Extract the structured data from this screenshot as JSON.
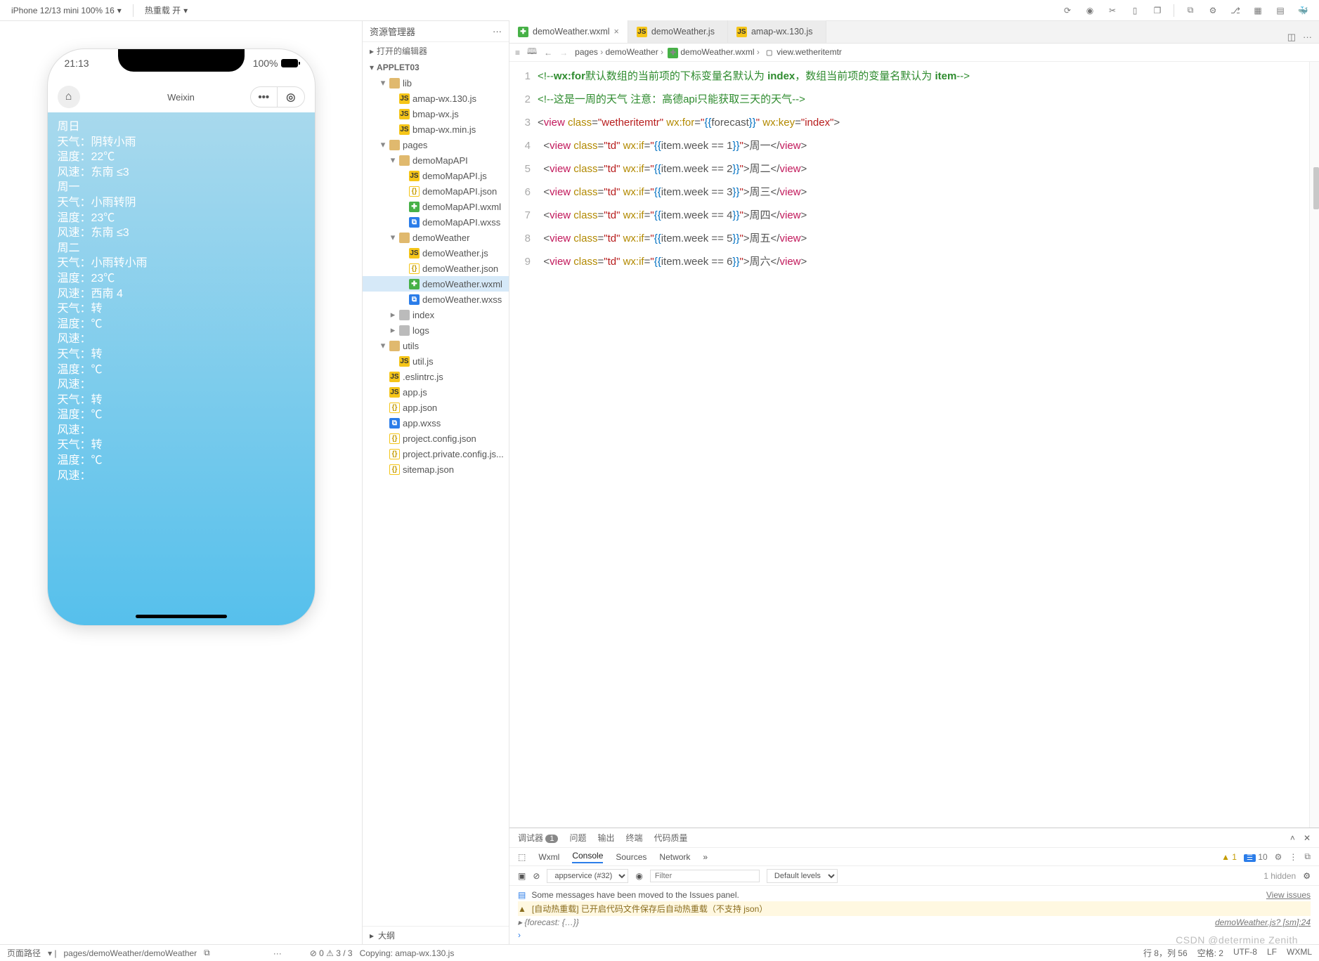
{
  "toolbar": {
    "device": "iPhone 12/13 mini 100% 16",
    "hot_reload": "热重载 开"
  },
  "simulator": {
    "time": "21:13",
    "battery": "100%",
    "title": "Weixin",
    "lines": [
      "周日",
      "天气：阴转小雨",
      "温度：22℃",
      "风速：东南 ≤3",
      "周一",
      "天气：小雨转阴",
      "温度：23℃",
      "风速：东南 ≤3",
      "周二",
      "天气：小雨转小雨",
      "温度：23℃",
      "风速：西南 4",
      "天气：转",
      "温度：℃",
      "风速：",
      "天气：转",
      "温度：℃",
      "风速：",
      "天气：转",
      "温度：℃",
      "风速：",
      "天气：转",
      "温度：℃",
      "风速："
    ]
  },
  "explorer": {
    "title": "资源管理器",
    "open_editors": "打开的编辑器",
    "project": "APPLET03",
    "outline": "大纲",
    "tree": [
      {
        "d": 1,
        "tw": "▾",
        "ic": "fold",
        "n": "lib"
      },
      {
        "d": 2,
        "ic": "js",
        "n": "amap-wx.130.js"
      },
      {
        "d": 2,
        "ic": "js",
        "n": "bmap-wx.js"
      },
      {
        "d": 2,
        "ic": "js",
        "n": "bmap-wx.min.js"
      },
      {
        "d": 1,
        "tw": "▾",
        "ic": "fold",
        "n": "pages"
      },
      {
        "d": 2,
        "tw": "▾",
        "ic": "fold",
        "n": "demoMapAPI"
      },
      {
        "d": 3,
        "ic": "js",
        "n": "demoMapAPI.js"
      },
      {
        "d": 3,
        "ic": "json",
        "n": "demoMapAPI.json"
      },
      {
        "d": 3,
        "ic": "wxml",
        "n": "demoMapAPI.wxml"
      },
      {
        "d": 3,
        "ic": "wxss",
        "n": "demoMapAPI.wxss"
      },
      {
        "d": 2,
        "tw": "▾",
        "ic": "fold",
        "n": "demoWeather"
      },
      {
        "d": 3,
        "ic": "js",
        "n": "demoWeather.js"
      },
      {
        "d": 3,
        "ic": "json",
        "n": "demoWeather.json"
      },
      {
        "d": 3,
        "ic": "wxml",
        "n": "demoWeather.wxml",
        "sel": true
      },
      {
        "d": 3,
        "ic": "wxss",
        "n": "demoWeather.wxss"
      },
      {
        "d": 2,
        "tw": "▸",
        "ic": "foldg",
        "n": "index"
      },
      {
        "d": 2,
        "tw": "▸",
        "ic": "foldg",
        "n": "logs"
      },
      {
        "d": 1,
        "tw": "▾",
        "ic": "fold",
        "n": "utils"
      },
      {
        "d": 2,
        "ic": "js",
        "n": "util.js"
      },
      {
        "d": 1,
        "ic": "js",
        "n": ".eslintrc.js"
      },
      {
        "d": 1,
        "ic": "js",
        "n": "app.js"
      },
      {
        "d": 1,
        "ic": "json",
        "n": "app.json"
      },
      {
        "d": 1,
        "ic": "wxss",
        "n": "app.wxss"
      },
      {
        "d": 1,
        "ic": "json",
        "n": "project.config.json"
      },
      {
        "d": 1,
        "ic": "json",
        "n": "project.private.config.js..."
      },
      {
        "d": 1,
        "ic": "json",
        "n": "sitemap.json"
      }
    ]
  },
  "tabs": [
    {
      "ic": "wxml",
      "label": "demoWeather.wxml",
      "active": true,
      "close": "×"
    },
    {
      "ic": "js",
      "label": "demoWeather.js",
      "close": ""
    },
    {
      "ic": "js",
      "label": "amap-wx.130.js",
      "close": ""
    }
  ],
  "breadcrumb": {
    "segments": [
      "pages",
      "demoWeather",
      "demoWeather.wxml",
      "view.wetheritemtr"
    ]
  },
  "code": {
    "lines": [
      {
        "n": 1,
        "html": "<span class='c-cm'>&lt;!--<b>wx:for</b>默认数组的当前项的下标变量名默认为 <b>index</b>，数组当前项的变量名默认为 <b>item</b>--&gt;</span>"
      },
      {
        "n": 2,
        "html": "<span class='c-cm'>&lt;!--这是一周的天气 注意：高德api只能获取三天的天气--&gt;</span>"
      },
      {
        "n": 3,
        "html": "&lt;<span class='c-tag'>view</span> <span class='c-attr'>class</span>=<span class='c-str'>\"wetheritemtr\"</span> <span class='c-attr'>wx:for</span>=<span class='c-str'>\"</span><span class='c-br'>{{</span>forecast<span class='c-br'>}}</span><span class='c-str'>\"</span> <span class='c-attr'>wx:key</span>=<span class='c-str'>\"index\"</span>&gt;"
      },
      {
        "n": 4,
        "html": "  &lt;<span class='c-tag'>view</span> <span class='c-attr'>class</span>=<span class='c-str'>\"td\"</span> <span class='c-attr'>wx:if</span>=<span class='c-str'>\"</span><span class='c-br'>{{</span>item.week == 1<span class='c-br'>}}</span><span class='c-str'>\"</span>&gt;周一&lt;/<span class='c-tag'>view</span>&gt;"
      },
      {
        "n": 5,
        "html": "  &lt;<span class='c-tag'>view</span> <span class='c-attr'>class</span>=<span class='c-str'>\"td\"</span> <span class='c-attr'>wx:if</span>=<span class='c-str'>\"</span><span class='c-br'>{{</span>item.week == 2<span class='c-br'>}}</span><span class='c-str'>\"</span>&gt;周二&lt;/<span class='c-tag'>view</span>&gt;"
      },
      {
        "n": 6,
        "html": "  &lt;<span class='c-tag'>view</span> <span class='c-attr'>class</span>=<span class='c-str'>\"td\"</span> <span class='c-attr'>wx:if</span>=<span class='c-str'>\"</span><span class='c-br'>{{</span>item.week == 3<span class='c-br'>}}</span><span class='c-str'>\"</span>&gt;周三&lt;/<span class='c-tag'>view</span>&gt;"
      },
      {
        "n": 7,
        "html": "  &lt;<span class='c-tag'>view</span> <span class='c-attr'>class</span>=<span class='c-str'>\"td\"</span> <span class='c-attr'>wx:if</span>=<span class='c-str'>\"</span><span class='c-br'>{{</span>item.week == 4<span class='c-br'>}}</span><span class='c-str'>\"</span>&gt;周四&lt;/<span class='c-tag'>view</span>&gt;"
      },
      {
        "n": 8,
        "html": "  &lt;<span class='c-tag'>view</span> <span class='c-attr'>class</span>=<span class='c-str'>\"td\"</span> <span class='c-attr'>wx:if</span>=<span class='c-str'>\"</span><span class='c-br'>{{</span>item.week == 5<span class='c-br'>}}</span><span class='c-str'>\"</span>&gt;周五&lt;/<span class='c-tag'>view</span>&gt;"
      },
      {
        "n": 9,
        "html": "  &lt;<span class='c-tag'>view</span> <span class='c-attr'>class</span>=<span class='c-str'>\"td\"</span> <span class='c-attr'>wx:if</span>=<span class='c-str'>\"</span><span class='c-br'>{{</span>item.week == 6<span class='c-br'>}}</span><span class='c-str'>\"</span>&gt;周六&lt;/<span class='c-tag'>view</span>&gt;"
      }
    ]
  },
  "debugger": {
    "tabs1": {
      "label": "调试器",
      "badge": "1",
      "issues": "问题",
      "output": "输出",
      "terminal": "终端",
      "quality": "代码质量"
    },
    "tabs2": {
      "wxml": "Wxml",
      "console": "Console",
      "sources": "Sources",
      "network": "Network",
      "warn_n": "1",
      "info_n": "10"
    },
    "filter": {
      "ctx": "appservice (#32)",
      "filter_ph": "Filter",
      "levels": "Default levels",
      "hidden": "1 hidden"
    },
    "msgs": {
      "issue": "Some messages have been moved to the Issues panel.",
      "issue_link": "View issues",
      "warn": "[自动热重载] 已开启代码文件保存后自动热重载（不支持 json）",
      "log": "▸ {forecast: {…}}",
      "log_src": "demoWeather.js? [sm]:24"
    }
  },
  "statusbar": {
    "left_label": "页面路径",
    "left_path": "pages/demoWeather/demoWeather",
    "counts": "0 ⚠ 3 / 3",
    "copying": "Copying: amap-wx.130.js",
    "pos": "行 8，列 56",
    "space": "空格: 2",
    "enc": "UTF-8",
    "eol": "LF",
    "lang": "WXML"
  },
  "watermark": "CSDN @determine  Zenith"
}
